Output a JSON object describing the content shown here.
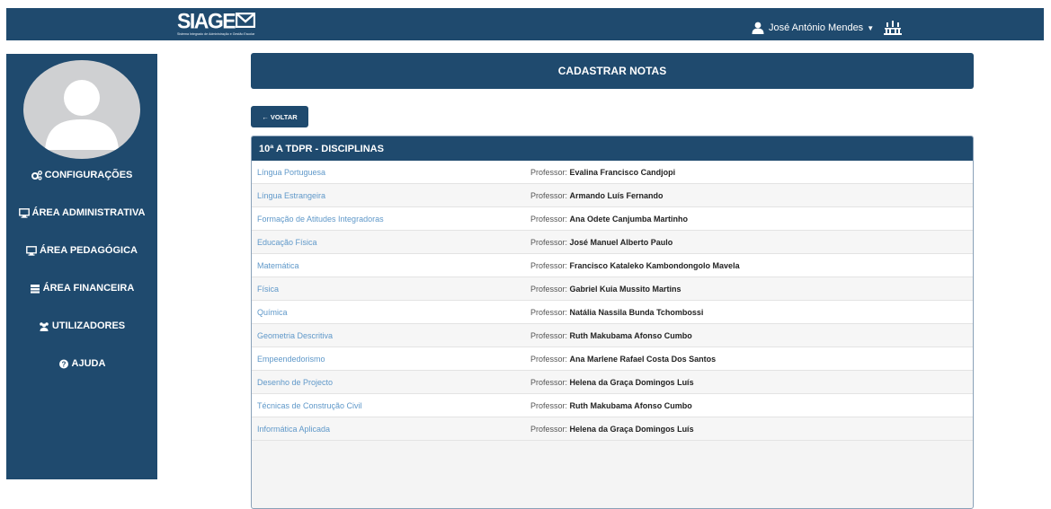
{
  "header": {
    "logo_text": "SIAGE",
    "logo_subtitle": "Sistema Integrado de Administração e Gestão Escolar",
    "user_name": "José António Mendes"
  },
  "sidebar": {
    "items": [
      {
        "label": "CONFIGURAÇÕES",
        "icon": "cogs-icon"
      },
      {
        "label": "ÁREA ADMINISTRATIVA",
        "icon": "display-icon"
      },
      {
        "label": "ÁREA PEDAGÓGICA",
        "icon": "display-icon"
      },
      {
        "label": "ÁREA FINANCEIRA",
        "icon": "money-icon"
      },
      {
        "label": "UTILIZADORES",
        "icon": "users-icon"
      },
      {
        "label": "AJUDA",
        "icon": "question-circle-icon"
      }
    ]
  },
  "main": {
    "title": "CADASTRAR NOTAS",
    "back_label": "← VOLTAR",
    "panel_title": "10ª A TDPR - DISCIPLINAS",
    "teacher_prefix": "Professor:",
    "rows": [
      {
        "subject": "Língua Portuguesa",
        "teacher": "Evalina Francisco Candjopi"
      },
      {
        "subject": "Língua Estrangeira",
        "teacher": "Armando Luís Fernando"
      },
      {
        "subject": "Formação de Atitudes Integradoras",
        "teacher": "Ana Odete Canjumba Martinho"
      },
      {
        "subject": "Educação Física",
        "teacher": "José Manuel Alberto Paulo"
      },
      {
        "subject": "Matemática",
        "teacher": "Francisco Kataleko Kambondongolo Mavela"
      },
      {
        "subject": "Física",
        "teacher": "Gabriel Kuia Mussito Martins"
      },
      {
        "subject": "Química",
        "teacher": "Natália Nassila Bunda Tchombossi"
      },
      {
        "subject": "Geometria Descritiva",
        "teacher": "Ruth Makubama Afonso Cumbo"
      },
      {
        "subject": "Empeendedorismo",
        "teacher": "Ana Marlene Rafael Costa Dos Santos"
      },
      {
        "subject": "Desenho de Projecto",
        "teacher": "Helena da Graça Domingos Luís"
      },
      {
        "subject": "Técnicas de Construção Civil",
        "teacher": "Ruth Makubama Afonso Cumbo"
      },
      {
        "subject": "Informática Aplicada",
        "teacher": "Helena da Graça Domingos Luís"
      }
    ]
  },
  "colors": {
    "primary": "#1f4a6e",
    "link": "#5f98c9",
    "avatar_bg": "#cfd0d2"
  }
}
